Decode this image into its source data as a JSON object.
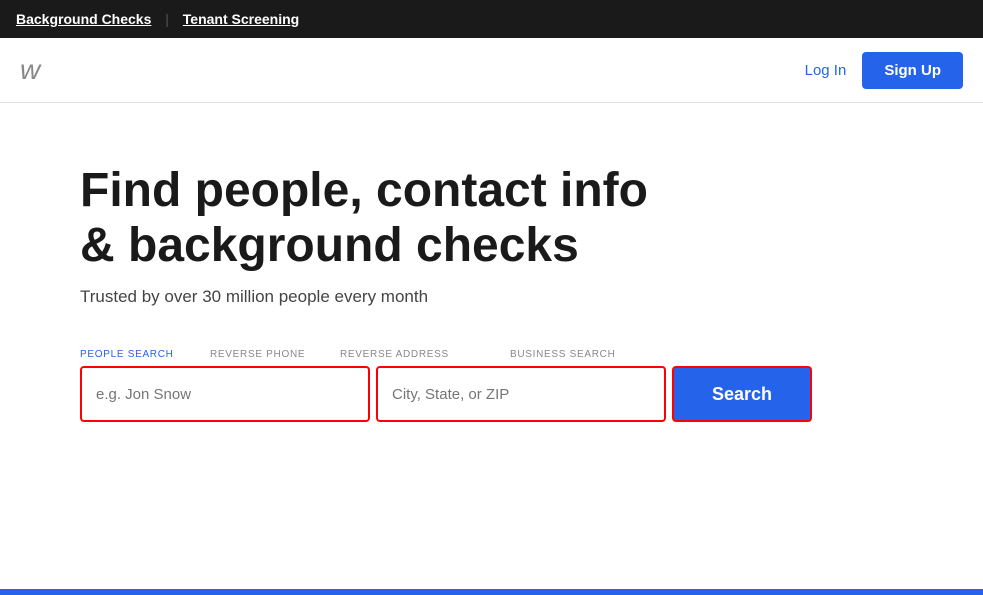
{
  "topbar": {
    "link1": "Background Checks",
    "divider": "|",
    "link2": "Tenant Screening"
  },
  "header": {
    "logo": "w",
    "login_label": "Log In",
    "signup_label": "Sign Up"
  },
  "hero": {
    "title": "Find people, contact info & background checks",
    "subtitle": "Trusted by over 30 million people every month"
  },
  "search": {
    "tabs": [
      {
        "label": "PEOPLE SEARCH",
        "active": true
      },
      {
        "label": "REVERSE PHONE",
        "active": false
      },
      {
        "label": "REVERSE ADDRESS",
        "active": false
      },
      {
        "label": "BUSINESS SEARCH",
        "active": false
      }
    ],
    "name_placeholder": "e.g. Jon Snow",
    "location_placeholder": "City, State, or ZIP",
    "button_label": "Search"
  }
}
